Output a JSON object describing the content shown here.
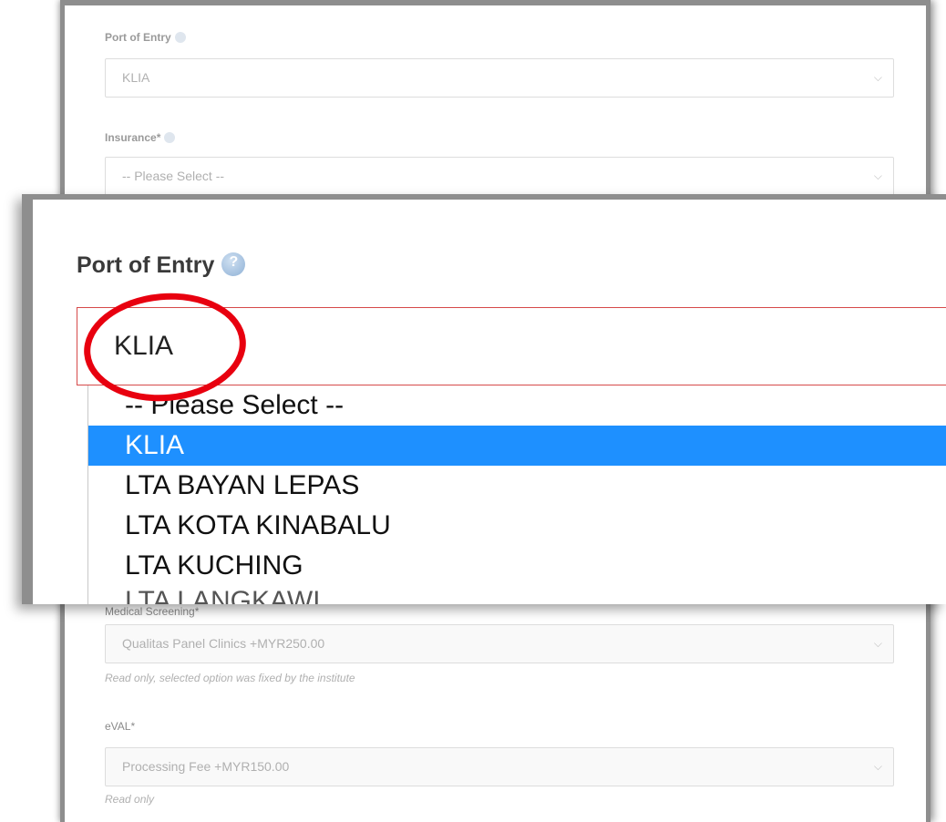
{
  "form": {
    "port_label": "Port of Entry",
    "port_value": "KLIA",
    "insurance_label": "Insurance*",
    "insurance_placeholder": "-- Please Select --",
    "medical_partial_label": "Medical Screening*",
    "medical_value": "Qualitas Panel Clinics +MYR250.00",
    "medical_note": "Read only, selected option was fixed by the institute",
    "eval_label": "eVAL*",
    "eval_value": "Processing Fee +MYR150.00",
    "eval_note": "Read only"
  },
  "zoom": {
    "label": "Port of Entry",
    "selected_value": "KLIA",
    "options": [
      "-- Please Select --",
      "KLIA",
      "LTA BAYAN LEPAS",
      "LTA KOTA KINABALU",
      "LTA KUCHING",
      "LTA LANGKAWI"
    ]
  },
  "icons": {
    "help": "help-circle-icon",
    "chevron": "chevron-down-icon"
  },
  "colors": {
    "highlight": "#1e90ff",
    "annotation": "#e8000f"
  }
}
